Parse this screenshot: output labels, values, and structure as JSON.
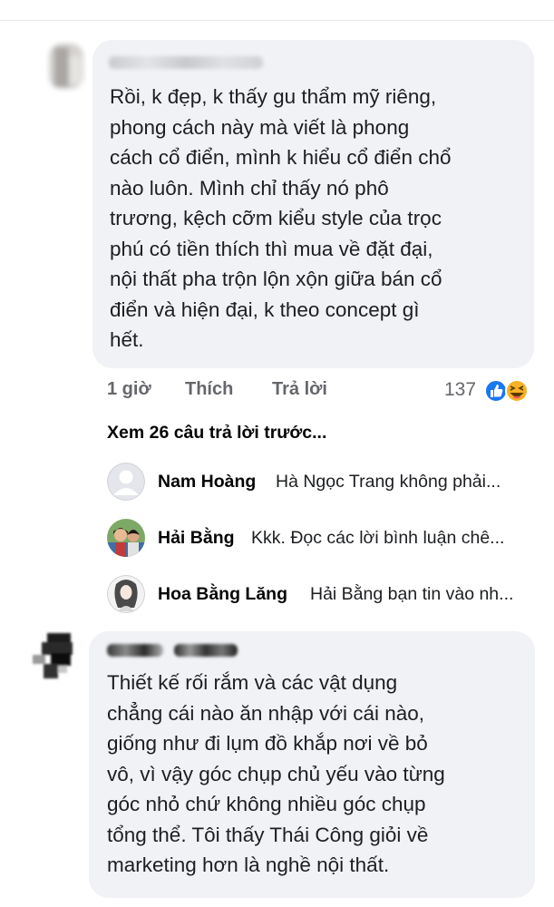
{
  "comments": [
    {
      "author": "",
      "text": "Rồi, k đẹp, k thấy gu thẩm mỹ riêng,\nphong cách này mà viết là phong\ncách cổ điển, mình k hiểu cổ điển chổ\nnào luôn. Mình chỉ thấy nó phô\ntrương, kệch cỡm kiểu style của trọc\nphú có tiền thích thì mua về đặt đại,\nnội thất pha trộn lộn xộn giữa bán cổ\nđiển và hiện đại, k theo concept gì\nhết.",
      "time": "1 giờ",
      "like_label": "Thích",
      "reply_label": "Trả lời",
      "reaction_count": "137",
      "reactions": [
        "like-icon",
        "haha-icon"
      ]
    },
    {
      "author": "",
      "text": "Thiết kế rối rắm và các vật dụng\nchẳng cái nào ăn nhập với cái nào,\ngiống như đi lụm đồ khắp nơi về bỏ\nvô, vì vậy góc chụp chủ yếu vào từng\ngóc nhỏ chứ không nhiều góc chụp\ntổng thể. Tôi thấy Thái Công giỏi về\nmarketing hơn là nghề nội thất."
    }
  ],
  "view_more_replies": "Xem 26 câu trả lời trước...",
  "replies": [
    {
      "name": "Nam Hoàng",
      "preview": "Hà Ngọc Trang không phải...",
      "avatar": "default-avatar-icon"
    },
    {
      "name": "Hải Bằng",
      "preview": "Kkk. Đọc các lời bình luận chê...",
      "avatar": "photo-avatar"
    },
    {
      "name": "Hoa Bằng Lăng",
      "preview": "Hải Bằng bạn tin vào nh...",
      "avatar": "illustration-avatar"
    }
  ],
  "colors": {
    "bubble": "#f0f2f5",
    "meta": "#65676b",
    "like": "#1877f2",
    "haha": "#f7b125"
  }
}
